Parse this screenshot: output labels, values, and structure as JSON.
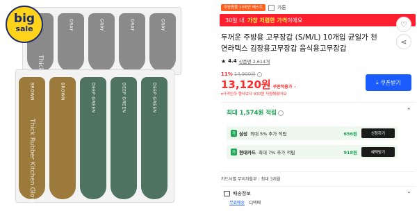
{
  "badge": {
    "line1": "big",
    "line2": "sale"
  },
  "product_image": {
    "back_pack_label": "GRAY",
    "back_pack_text": "Thick Rubber",
    "front_pack_labels": [
      "BROWN",
      "DEEP GREEN"
    ],
    "front_pack_text": "Thick Rubber Kitchen Gloves",
    "colors": {
      "gray": "#8a8a8a",
      "brown": "#9b7a3c",
      "green": "#4f7361"
    }
  },
  "store": {
    "tag": "주방용품 10위안 베스트",
    "brand": "가톤"
  },
  "banner": {
    "prefix": "30일 내",
    "emphasis": "가장 저렴한 가격",
    "suffix": "이에요"
  },
  "product": {
    "title": "두꺼운 주방용 고무장갑 (S/M/L) 10개입 균일가 천연라텍스 김장용고무장갑 음식용고무장갑"
  },
  "rating": {
    "score": "4.4",
    "reviews": "상품평 2,614개"
  },
  "price": {
    "discount": "11%",
    "original": "14,900원",
    "final": "13,120원",
    "label": "쿠폰적용가",
    "note": "가격인하 행사보다 930원 저렴해졌어요"
  },
  "coupon_button": {
    "label": "쿠폰받기",
    "icon": "download-icon"
  },
  "max_points": {
    "title": "최대 1,574원 적립",
    "cards": [
      {
        "icon": "카",
        "name": "삼성",
        "desc": "최대 5% 추가 적립",
        "points": "656원",
        "button": "신청하기"
      },
      {
        "icon": "카",
        "name": "현대카드",
        "desc": "최대 7% 추가 적립",
        "points": "918원",
        "button": "혜택받기"
      }
    ]
  },
  "installment": {
    "left": "카드사별 무이자할부",
    "right": "최대 3개월"
  },
  "shipping": {
    "title": "배송정보",
    "free": "무료배송",
    "courier": "CJ택배"
  },
  "accent_colors": {
    "red": "#ff1f2e",
    "blue": "#1a5cff",
    "green": "#1ea556"
  }
}
